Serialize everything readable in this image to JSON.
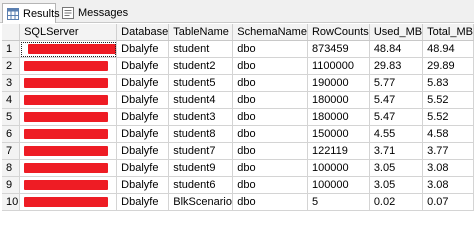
{
  "tabs": [
    {
      "label": "Results",
      "icon": "results-grid-icon",
      "active": true
    },
    {
      "label": "Messages",
      "icon": "messages-icon",
      "active": false
    }
  ],
  "columns": [
    "",
    "SQLServer",
    "Database",
    "TableName",
    "SchemaName",
    "RowCounts",
    "Used_MB",
    "Total_MB"
  ],
  "rows": [
    {
      "num": "1",
      "database": "Dbalyfe",
      "table": "student",
      "schema": "dbo",
      "rowcounts": "873459",
      "used": "48.84",
      "total": "48.94"
    },
    {
      "num": "2",
      "database": "Dbalyfe",
      "table": "student2",
      "schema": "dbo",
      "rowcounts": "1100000",
      "used": "29.83",
      "total": "29.89"
    },
    {
      "num": "3",
      "database": "Dbalyfe",
      "table": "student5",
      "schema": "dbo",
      "rowcounts": "190000",
      "used": "5.77",
      "total": "5.83"
    },
    {
      "num": "4",
      "database": "Dbalyfe",
      "table": "student4",
      "schema": "dbo",
      "rowcounts": "180000",
      "used": "5.47",
      "total": "5.52"
    },
    {
      "num": "5",
      "database": "Dbalyfe",
      "table": "student3",
      "schema": "dbo",
      "rowcounts": "180000",
      "used": "5.47",
      "total": "5.52"
    },
    {
      "num": "6",
      "database": "Dbalyfe",
      "table": "student8",
      "schema": "dbo",
      "rowcounts": "150000",
      "used": "4.55",
      "total": "4.58"
    },
    {
      "num": "7",
      "database": "Dbalyfe",
      "table": "student7",
      "schema": "dbo",
      "rowcounts": "122119",
      "used": "3.71",
      "total": "3.77"
    },
    {
      "num": "8",
      "database": "Dbalyfe",
      "table": "student9",
      "schema": "dbo",
      "rowcounts": "100000",
      "used": "3.05",
      "total": "3.08"
    },
    {
      "num": "9",
      "database": "Dbalyfe",
      "table": "student6",
      "schema": "dbo",
      "rowcounts": "100000",
      "used": "3.05",
      "total": "3.08"
    },
    {
      "num": "10",
      "database": "Dbalyfe",
      "table": "BlkScenario",
      "schema": "dbo",
      "rowcounts": "5",
      "used": "0.02",
      "total": "0.07"
    }
  ],
  "colors": {
    "redaction": "#ee1c24",
    "header_bg": "#f3f3f3",
    "gridline": "#d4d4d4"
  }
}
